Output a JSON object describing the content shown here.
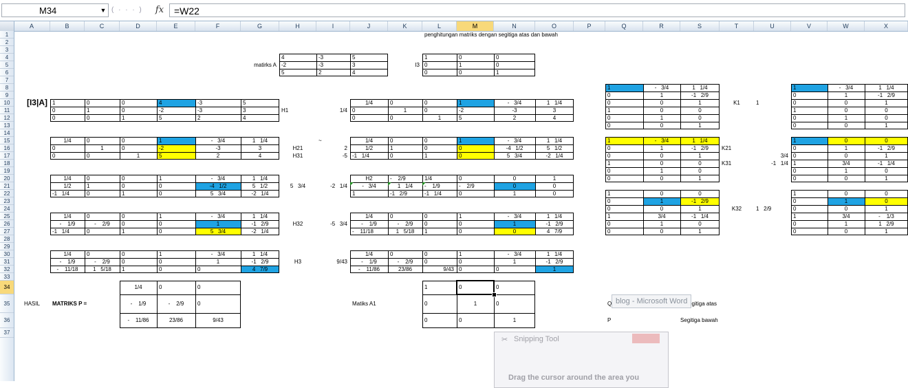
{
  "formula_bar": {
    "name_box": "M34",
    "formula": "=W22",
    "fx_label": "fx"
  },
  "columns": [
    "A",
    "B",
    "C",
    "D",
    "E",
    "F",
    "G",
    "H",
    "I",
    "J",
    "K",
    "L",
    "M",
    "N",
    "O",
    "P",
    "Q",
    "R",
    "S",
    "T",
    "U",
    "V",
    "W",
    "X"
  ],
  "selected_column": "M",
  "selected_row": "34",
  "rows": [
    "1",
    "2",
    "3",
    "4",
    "5",
    "6",
    "7",
    "8",
    "9",
    "10",
    "11",
    "12",
    "13",
    "14",
    "15",
    "16",
    "17",
    "18",
    "19",
    "20",
    "21",
    "22",
    "23",
    "24",
    "25",
    "26",
    "27",
    "28",
    "29",
    "30",
    "31",
    "32",
    "33",
    "34",
    "35",
    "36",
    "37"
  ],
  "cells": [
    {
      "t": "penghitungan matriks dengan segitiga atas dan bawah",
      "k": "title"
    },
    {
      "t": "matirks A"
    },
    {
      "t": "4"
    },
    {
      "t": "-3"
    },
    {
      "t": "5"
    },
    {
      "t": "-2"
    },
    {
      "t": "-3"
    },
    {
      "t": "3"
    },
    {
      "t": "5"
    },
    {
      "t": "2"
    },
    {
      "t": "4"
    },
    {
      "t": "I3"
    },
    {
      "t": "1"
    },
    {
      "t": "0"
    },
    {
      "t": "0"
    },
    {
      "t": "0"
    },
    {
      "t": "1"
    },
    {
      "t": "0"
    },
    {
      "t": "0"
    },
    {
      "t": "0"
    },
    {
      "t": "1"
    },
    {
      "t": "[I3|A]",
      "k": "big"
    },
    {
      "t": "1"
    },
    {
      "t": "0"
    },
    {
      "t": "0"
    },
    {
      "t": "4"
    },
    {
      "t": "-3"
    },
    {
      "t": "5"
    },
    {
      "t": "0"
    },
    {
      "t": "1"
    },
    {
      "t": "0"
    },
    {
      "t": "-2"
    },
    {
      "t": "-3"
    },
    {
      "t": "3"
    },
    {
      "t": "0"
    },
    {
      "t": "0"
    },
    {
      "t": "1"
    },
    {
      "t": "5"
    },
    {
      "t": "2"
    },
    {
      "t": "4"
    },
    {
      "t": "H1"
    },
    {
      "t": "1/4"
    },
    {
      "t": "1/4"
    },
    {
      "t": "0"
    },
    {
      "t": "0"
    },
    {
      "t": "1"
    },
    {
      "t": "-   3/4"
    },
    {
      "t": "1   1/4"
    },
    {
      "t": "0"
    },
    {
      "t": "1"
    },
    {
      "t": "0"
    },
    {
      "t": "-2"
    },
    {
      "t": "-3"
    },
    {
      "t": "3"
    },
    {
      "t": "0"
    },
    {
      "t": "0"
    },
    {
      "t": "1"
    },
    {
      "t": "5"
    },
    {
      "t": "2"
    },
    {
      "t": "4"
    },
    {
      "t": "1/4"
    },
    {
      "t": "0"
    },
    {
      "t": "0"
    },
    {
      "t": "1"
    },
    {
      "t": "-   3/4"
    },
    {
      "t": "1   1/4"
    },
    {
      "t": "0"
    },
    {
      "t": "1"
    },
    {
      "t": "0"
    },
    {
      "t": "-2"
    },
    {
      "t": "-3"
    },
    {
      "t": "3"
    },
    {
      "t": "0"
    },
    {
      "t": "0"
    },
    {
      "t": "1"
    },
    {
      "t": "5"
    },
    {
      "t": "2"
    },
    {
      "t": "4"
    },
    {
      "t": "~"
    },
    {
      "t": "H21"
    },
    {
      "t": "2"
    },
    {
      "t": "H31"
    },
    {
      "t": "-5"
    },
    {
      "t": "1/4"
    },
    {
      "t": "0"
    },
    {
      "t": "0"
    },
    {
      "t": "1"
    },
    {
      "t": "-   3/4"
    },
    {
      "t": "1   1/4"
    },
    {
      "t": "1/2"
    },
    {
      "t": "1"
    },
    {
      "t": "0"
    },
    {
      "t": "0"
    },
    {
      "t": "-4   1/2"
    },
    {
      "t": "5   1/2"
    },
    {
      "t": "-1   1/4"
    },
    {
      "t": "0"
    },
    {
      "t": "1"
    },
    {
      "t": "0"
    },
    {
      "t": "5   3/4"
    },
    {
      "t": "-2   1/4"
    },
    {
      "t": "1/4"
    },
    {
      "t": "0"
    },
    {
      "t": "0"
    },
    {
      "t": "1"
    },
    {
      "t": "-   3/4"
    },
    {
      "t": "1   1/4"
    },
    {
      "t": "1/2"
    },
    {
      "t": "1"
    },
    {
      "t": "0"
    },
    {
      "t": "0"
    },
    {
      "t": "-4   1/2"
    },
    {
      "t": "5   1/2"
    },
    {
      "t": "-1   1/4"
    },
    {
      "t": "0"
    },
    {
      "t": "1"
    },
    {
      "t": "0"
    },
    {
      "t": "5   3/4"
    },
    {
      "t": "-2   1/4"
    },
    {
      "t": "H2"
    },
    {
      "t": "-    2/9"
    },
    {
      "t": "1/4"
    },
    {
      "t": "0"
    },
    {
      "t": "0"
    },
    {
      "t": "1"
    },
    {
      "t": "-   3/4"
    },
    {
      "t": "1   1/4"
    },
    {
      "t": "-    1/9"
    },
    {
      "t": "-    2/9"
    },
    {
      "t": "0"
    },
    {
      "t": "0"
    },
    {
      "t": "1"
    },
    {
      "t": "-1   2/9"
    },
    {
      "t": "-1   1/4"
    },
    {
      "t": "0"
    },
    {
      "t": "1"
    },
    {
      "t": "0"
    },
    {
      "t": "5   3/4"
    },
    {
      "t": "-2   1/4"
    },
    {
      "t": "1/4"
    },
    {
      "t": "0"
    },
    {
      "t": "0"
    },
    {
      "t": "1"
    },
    {
      "t": "-   3/4"
    },
    {
      "t": "1   1/4"
    },
    {
      "t": "-    1/9"
    },
    {
      "t": "-    2/9"
    },
    {
      "t": "0"
    },
    {
      "t": "0"
    },
    {
      "t": "1"
    },
    {
      "t": "-1   2/9"
    },
    {
      "t": "-1   1/4"
    },
    {
      "t": "0"
    },
    {
      "t": "1"
    },
    {
      "t": "0"
    },
    {
      "t": "5   3/4"
    },
    {
      "t": "-2   1/4"
    },
    {
      "t": "H32"
    },
    {
      "t": "-5   3/4"
    },
    {
      "t": "1/4"
    },
    {
      "t": "0"
    },
    {
      "t": "0"
    },
    {
      "t": "1"
    },
    {
      "t": "-   3/4"
    },
    {
      "t": "1   1/4"
    },
    {
      "t": "-    1/9"
    },
    {
      "t": "-    2/9"
    },
    {
      "t": "0"
    },
    {
      "t": "0"
    },
    {
      "t": "1"
    },
    {
      "t": "-1   2/9"
    },
    {
      "t": "-    11/18"
    },
    {
      "t": "1   5/18"
    },
    {
      "t": "1"
    },
    {
      "t": "0"
    },
    {
      "t": "0"
    },
    {
      "t": "4   7/9"
    },
    {
      "t": "1/4"
    },
    {
      "t": "0"
    },
    {
      "t": "0"
    },
    {
      "t": "1"
    },
    {
      "t": "-   3/4"
    },
    {
      "t": "1   1/4"
    },
    {
      "t": "-    1/9"
    },
    {
      "t": "-    2/9"
    },
    {
      "t": "0"
    },
    {
      "t": "0"
    },
    {
      "t": "1"
    },
    {
      "t": "-1   2/9"
    },
    {
      "t": "-    11/18"
    },
    {
      "t": "1   5/18"
    },
    {
      "t": "1"
    },
    {
      "t": "0"
    },
    {
      "t": "0"
    },
    {
      "t": "4   7/9"
    },
    {
      "t": "H3"
    },
    {
      "t": "9/43"
    },
    {
      "t": "1/4"
    },
    {
      "t": "0"
    },
    {
      "t": "0"
    },
    {
      "t": "1"
    },
    {
      "t": "-   3/4"
    },
    {
      "t": "1   1/4"
    },
    {
      "t": "-    1/9"
    },
    {
      "t": "-    2/9"
    },
    {
      "t": "0"
    },
    {
      "t": "0"
    },
    {
      "t": "1"
    },
    {
      "t": "-1   2/9"
    },
    {
      "t": "-    11/86"
    },
    {
      "t": "23/86"
    },
    {
      "t": "9/43"
    },
    {
      "t": "0"
    },
    {
      "t": "0"
    },
    {
      "t": "1"
    },
    {
      "t": "1"
    },
    {
      "t": "-   3/4"
    },
    {
      "t": "1   1/4"
    },
    {
      "t": "0"
    },
    {
      "t": "1"
    },
    {
      "t": "-1   2/9"
    },
    {
      "t": "0"
    },
    {
      "t": "0"
    },
    {
      "t": "1"
    },
    {
      "t": "1"
    },
    {
      "t": "0"
    },
    {
      "t": "0"
    },
    {
      "t": "0"
    },
    {
      "t": "1"
    },
    {
      "t": "0"
    },
    {
      "t": "0"
    },
    {
      "t": "0"
    },
    {
      "t": "1"
    },
    {
      "t": "K1"
    },
    {
      "t": "1"
    },
    {
      "t": "1"
    },
    {
      "t": "-   3/4"
    },
    {
      "t": "1   1/4"
    },
    {
      "t": "0"
    },
    {
      "t": "1"
    },
    {
      "t": "-1   2/9"
    },
    {
      "t": "0"
    },
    {
      "t": "0"
    },
    {
      "t": "1"
    },
    {
      "t": "1"
    },
    {
      "t": "0"
    },
    {
      "t": "0"
    },
    {
      "t": "0"
    },
    {
      "t": "1"
    },
    {
      "t": "0"
    },
    {
      "t": "0"
    },
    {
      "t": "0"
    },
    {
      "t": "1"
    },
    {
      "t": "1"
    },
    {
      "t": "-   3/4"
    },
    {
      "t": "1   1/4"
    },
    {
      "t": "0"
    },
    {
      "t": "1"
    },
    {
      "t": "-1   2/9"
    },
    {
      "t": "0"
    },
    {
      "t": "0"
    },
    {
      "t": "1"
    },
    {
      "t": "1"
    },
    {
      "t": "0"
    },
    {
      "t": "0"
    },
    {
      "t": "0"
    },
    {
      "t": "1"
    },
    {
      "t": "0"
    },
    {
      "t": "0"
    },
    {
      "t": "0"
    },
    {
      "t": "1"
    },
    {
      "t": "K21"
    },
    {
      "t": "3/4"
    },
    {
      "t": "K31"
    },
    {
      "t": "-1   1/4"
    },
    {
      "t": "1"
    },
    {
      "t": "0"
    },
    {
      "t": "0"
    },
    {
      "t": "0"
    },
    {
      "t": "1"
    },
    {
      "t": "-1   2/9"
    },
    {
      "t": "0"
    },
    {
      "t": "0"
    },
    {
      "t": "1"
    },
    {
      "t": "1"
    },
    {
      "t": "3/4"
    },
    {
      "t": "-1   1/4"
    },
    {
      "t": "0"
    },
    {
      "t": "1"
    },
    {
      "t": "0"
    },
    {
      "t": "0"
    },
    {
      "t": "0"
    },
    {
      "t": "1"
    },
    {
      "t": "1"
    },
    {
      "t": "0"
    },
    {
      "t": "0"
    },
    {
      "t": "0"
    },
    {
      "t": "1"
    },
    {
      "t": "-1   2/9"
    },
    {
      "t": "0"
    },
    {
      "t": "0"
    },
    {
      "t": "1"
    },
    {
      "t": "1"
    },
    {
      "t": "3/4"
    },
    {
      "t": "-1   1/4"
    },
    {
      "t": "0"
    },
    {
      "t": "1"
    },
    {
      "t": "0"
    },
    {
      "t": "0"
    },
    {
      "t": "0"
    },
    {
      "t": "1"
    },
    {
      "t": "K32"
    },
    {
      "t": "1   2/9"
    },
    {
      "t": "1"
    },
    {
      "t": "0"
    },
    {
      "t": "0"
    },
    {
      "t": "0"
    },
    {
      "t": "1"
    },
    {
      "t": "0"
    },
    {
      "t": "0"
    },
    {
      "t": "0"
    },
    {
      "t": "1"
    },
    {
      "t": "1"
    },
    {
      "t": "3/4"
    },
    {
      "t": "-    1/3"
    },
    {
      "t": "0"
    },
    {
      "t": "1"
    },
    {
      "t": "1   2/9"
    },
    {
      "t": "0"
    },
    {
      "t": "0"
    },
    {
      "t": "1"
    },
    {
      "t": "HASIL"
    },
    {
      "t": "MATRIKS P =",
      "k": "bold"
    },
    {
      "t": "1/4"
    },
    {
      "t": "0"
    },
    {
      "t": "0"
    },
    {
      "t": "-    1/9"
    },
    {
      "t": "-    2/9"
    },
    {
      "t": "0"
    },
    {
      "t": "-    11/86"
    },
    {
      "t": "23/86"
    },
    {
      "t": "9/43"
    },
    {
      "t": "Matiks A1"
    },
    {
      "t": "1"
    },
    {
      "t": "0"
    },
    {
      "t": "0"
    },
    {
      "t": "0"
    },
    {
      "t": "1"
    },
    {
      "t": "0"
    },
    {
      "t": "0"
    },
    {
      "t": "0"
    },
    {
      "t": "1"
    },
    {
      "t": "Q"
    },
    {
      "t": "Segitiga atas"
    },
    {
      "t": "P"
    },
    {
      "t": "Segitiga bawah"
    }
  ],
  "overlays": {
    "word_tooltip": "blog - Microsoft Word",
    "snipping_title": "Snipping Tool",
    "snipping_hint": "Drag the cursor around the area you"
  },
  "colors": {
    "blue": "#1fa3e3",
    "yellow": "#ffff00",
    "header_selected": "#f8d97a"
  }
}
